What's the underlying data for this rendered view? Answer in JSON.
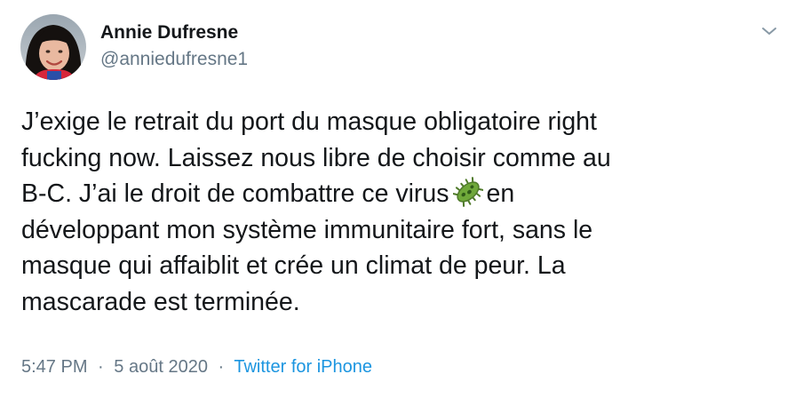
{
  "author": {
    "display_name": "Annie Dufresne",
    "handle": "@anniedufresne1"
  },
  "tweet": {
    "lines": [
      "J’exige le retrait du port du masque obligatoire right",
      "fucking now. Laissez nous libre de choisir comme au",
      "B-C. J’ai le droit de combattre ce virus",
      "en",
      "développant mon système immunitaire fort, sans le",
      "masque qui affaiblit et crée un climat de peur. La",
      "mascarade est terminée."
    ],
    "emoji": "microbe-emoji"
  },
  "meta": {
    "time": "5:47 PM",
    "separator": "·",
    "date": "5 août 2020",
    "source": "Twitter for iPhone"
  },
  "icons": {
    "menu": "chevron-down-icon"
  },
  "colors": {
    "text": "#14171a",
    "secondary": "#657786",
    "link": "#1b95e0",
    "background": "#ffffff"
  }
}
